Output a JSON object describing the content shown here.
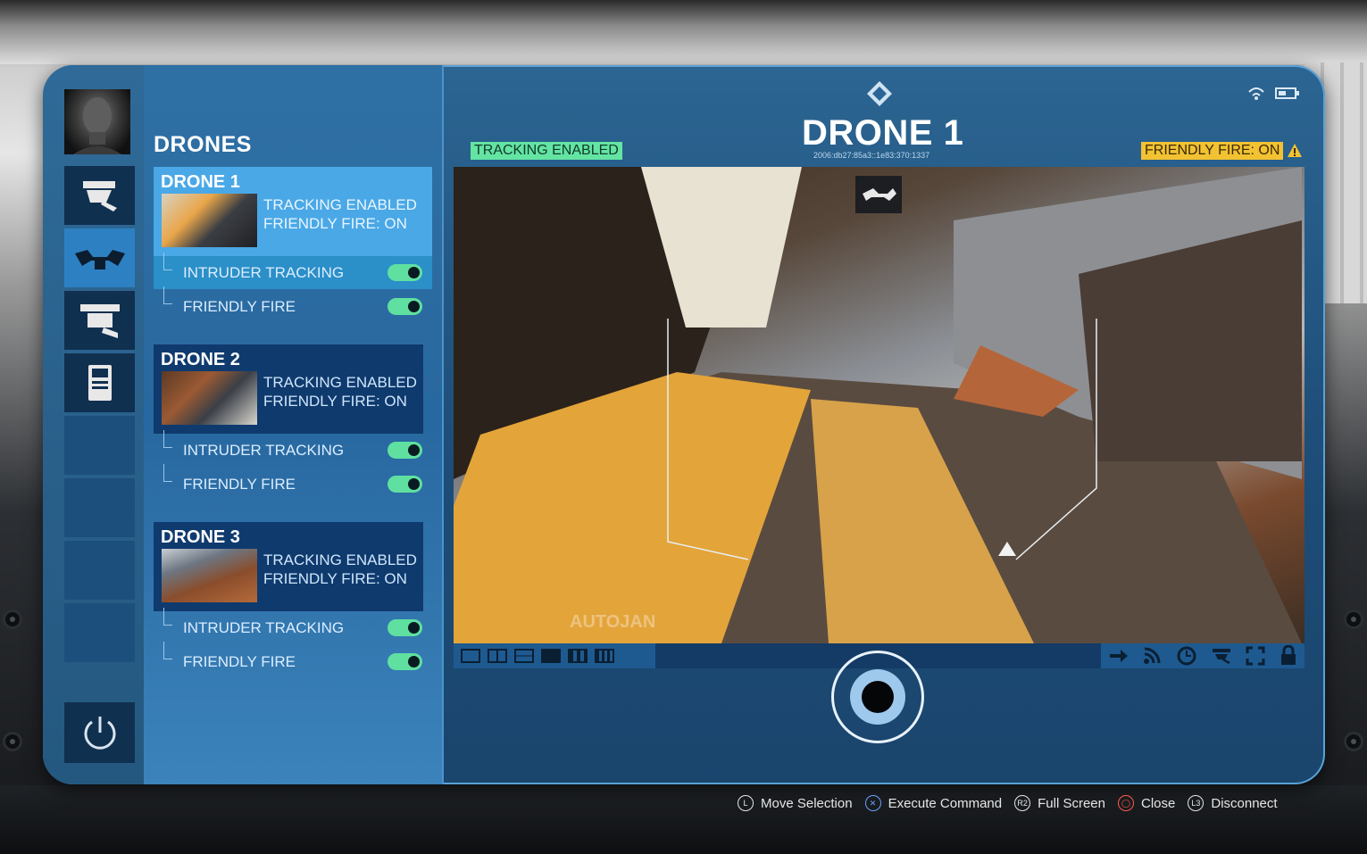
{
  "sidebar": {
    "title": "DRONES",
    "rail_icons": [
      "avatar-icon",
      "camera-icon",
      "drone-icon",
      "turret-icon",
      "terminal-icon"
    ],
    "power_icon": "power-icon"
  },
  "drones": [
    {
      "name": "DRONE 1",
      "status_tracking": "TRACKING ENABLED",
      "status_ff": "FRIENDLY FIRE: ON",
      "options": [
        {
          "label": "INTRUDER TRACKING",
          "on": true
        },
        {
          "label": "FRIENDLY FIRE",
          "on": true
        }
      ]
    },
    {
      "name": "DRONE 2",
      "status_tracking": "TRACKING ENABLED",
      "status_ff": "FRIENDLY FIRE: ON",
      "options": [
        {
          "label": "INTRUDER TRACKING",
          "on": true
        },
        {
          "label": "FRIENDLY FIRE",
          "on": true
        }
      ]
    },
    {
      "name": "DRONE 3",
      "status_tracking": "TRACKING ENABLED",
      "status_ff": "FRIENDLY FIRE: ON",
      "options": [
        {
          "label": "INTRUDER TRACKING",
          "on": true
        },
        {
          "label": "FRIENDLY FIRE",
          "on": true
        }
      ]
    }
  ],
  "main": {
    "title": "DRONE 1",
    "address": "2006:db27:85a3::1e83:370:1337",
    "tracking_badge": "TRACKING ENABLED",
    "ff_badge": "FRIENDLY FIRE: ON",
    "feed_overlay_text": "AUTOJAN"
  },
  "toolbar": {
    "layouts": [
      "layout-1-icon",
      "layout-2-icon",
      "layout-3-icon",
      "layout-4-icon",
      "layout-5-icon",
      "layout-6-icon"
    ],
    "actions": [
      "arrow-icon",
      "signal-icon",
      "clock-icon",
      "camera-icon",
      "fullscreen-icon",
      "lock-icon"
    ]
  },
  "hints": [
    {
      "button": "L",
      "label": "Move Selection"
    },
    {
      "button": "✕",
      "label": "Execute Command"
    },
    {
      "button": "R2",
      "label": "Full Screen"
    },
    {
      "button": "◯",
      "label": "Close"
    },
    {
      "button": "L3",
      "label": "Disconnect"
    }
  ],
  "colors": {
    "accent": "#4aa8e6",
    "toggle_on": "#5fe0a0",
    "badge_green": "#64e4a3",
    "badge_yellow": "#f2c233"
  }
}
